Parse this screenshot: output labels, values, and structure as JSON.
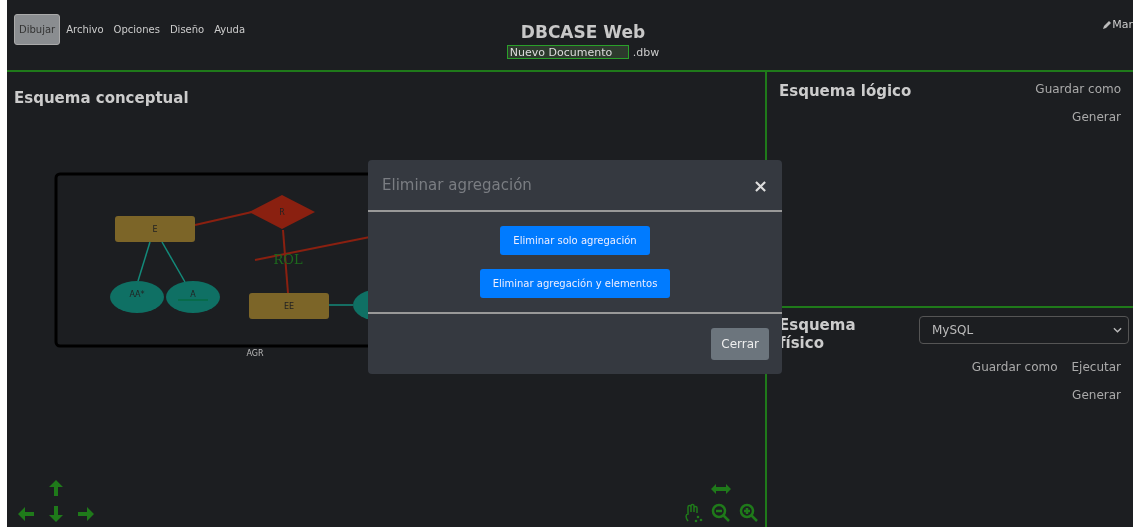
{
  "menu": [
    {
      "label": "Dibujar",
      "selected": true
    },
    {
      "label": "Archivo",
      "selected": false
    },
    {
      "label": "Opciones",
      "selected": false
    },
    {
      "label": "Diseño",
      "selected": false
    },
    {
      "label": "Ayuda",
      "selected": false
    }
  ],
  "app_title": "DBCASE Web",
  "document": {
    "value": "Nuevo Documento",
    "extension": ".dbw"
  },
  "user": "Mar",
  "conceptual": {
    "title": "Esquema conceptual",
    "diagram": {
      "entities": [
        {
          "label": "E"
        },
        {
          "label": "EE"
        }
      ],
      "relation": {
        "label": "R"
      },
      "attributes": [
        {
          "label": "AA*",
          "key": false
        },
        {
          "label": "A",
          "key": true
        }
      ],
      "role": "ROL",
      "aggregation": "AGR"
    }
  },
  "logical": {
    "title": "Esquema lógico",
    "actions": [
      "Guardar como",
      "Generar"
    ]
  },
  "physical": {
    "title": "Esquema físico",
    "engine": "MySQL",
    "actions": [
      "Guardar como",
      "Ejecutar",
      "Generar"
    ]
  },
  "modal": {
    "title": "Eliminar agregación",
    "close": "×",
    "options": [
      "Eliminar solo agregación",
      "Eliminar agregación y elementos"
    ],
    "footer_button": "Cerrar"
  }
}
